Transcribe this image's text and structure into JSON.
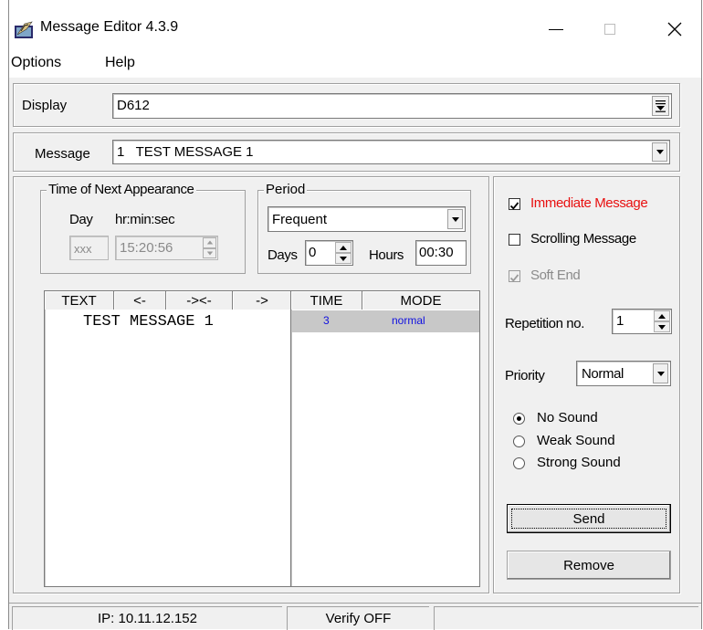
{
  "window": {
    "title": "Message Editor 4.3.9",
    "minimize_glyph": "—",
    "maximize_glyph": "☐",
    "close_glyph": "✕"
  },
  "menu": [
    "Options",
    "Help"
  ],
  "display": {
    "label": "Display",
    "value": "D612"
  },
  "message": {
    "label": "Message",
    "value": "1   TEST MESSAGE 1"
  },
  "time_next": {
    "title": "Time of Next Appearance",
    "day_label": "Day",
    "time_label": "hr:min:sec",
    "day_value": "xxx",
    "time_value": "15:20:56"
  },
  "period": {
    "title": "Period",
    "value": "Frequent",
    "days_label": "Days",
    "days_value": "0",
    "hours_label": "Hours",
    "hours_value": "00:30"
  },
  "text_table": {
    "headers": [
      "TEXT",
      "<-",
      "-><-",
      "->"
    ],
    "rows": [
      "TEST MESSAGE 1"
    ]
  },
  "time_table": {
    "headers": [
      "TIME",
      "MODE"
    ],
    "rows": [
      {
        "time": "3",
        "mode": "normal"
      }
    ]
  },
  "options": {
    "immediate": {
      "label": "Immediate Message",
      "checked": true,
      "color": "#e81010"
    },
    "scrolling": {
      "label": "Scrolling Message",
      "checked": false
    },
    "soft_end": {
      "label": "Soft End",
      "checked": true,
      "disabled": true
    }
  },
  "repetition": {
    "label": "Repetition no.",
    "value": "1"
  },
  "priority": {
    "label": "Priority",
    "value": "Normal"
  },
  "sound": {
    "options": [
      "No Sound",
      "Weak Sound",
      "Strong Sound"
    ],
    "selected": "No Sound"
  },
  "buttons": {
    "send": "Send",
    "remove": "Remove"
  },
  "status": {
    "ip": "IP: 10.11.12.152",
    "verify": "Verify OFF"
  },
  "colors": {
    "time_mode_text": "#1010e0",
    "selected_row_bg": "#c8c8c8",
    "immediate_text": "#e81010"
  }
}
